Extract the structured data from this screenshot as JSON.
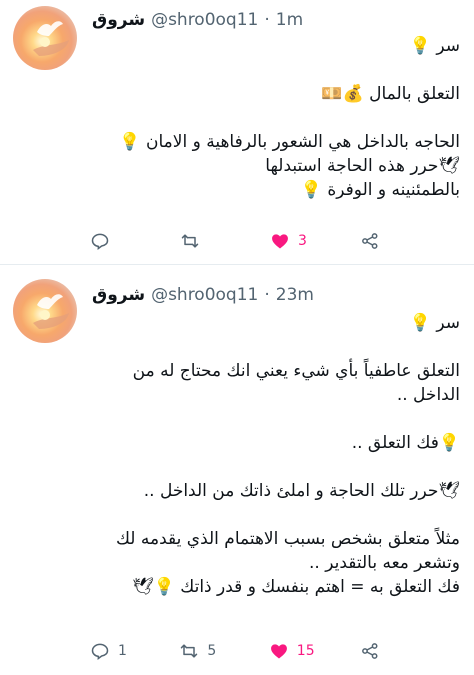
{
  "tweets": [
    {
      "name": "شروق",
      "handle": "@shro0oq11",
      "separator": "·",
      "time": "1m",
      "lines": [
        "سر 💡",
        "",
        "التعلق بالمال 💰💴",
        "",
        "الحاجه بالداخل هي الشعور بالرفاهية و الامان 💡",
        "🕊حرر هذه الحاجة استبدلها",
        "بالطمئنينه و الوفرة 💡"
      ],
      "actions": {
        "reply": "",
        "retweet": "",
        "like": "3"
      }
    },
    {
      "name": "شروق",
      "handle": "@shro0oq11",
      "separator": "·",
      "time": "23m",
      "lines": [
        "سر 💡",
        "",
        "التعلق عاطفياً بأي شيء يعني انك محتاج له من",
        "الداخل ..",
        "",
        "💡فك التعلق ..",
        "",
        "🕊حرر تلك الحاجة و املئ ذاتك من الداخل ..",
        "",
        "مثلاً متعلق بشخص بسبب الاهتمام الذي يقدمه لك",
        "وتشعر معه بالتقدير ..",
        "فك التعلق به = اهتم بنفسك و قدر ذاتك 💡🕊"
      ],
      "actions": {
        "reply": "1",
        "retweet": "5",
        "like": "15"
      }
    }
  ],
  "colors": {
    "like": "#f91880",
    "muted": "#536471",
    "divider": "#e6ecf0"
  },
  "icons": [
    "reply-icon",
    "retweet-icon",
    "heart-icon",
    "share-icon"
  ]
}
